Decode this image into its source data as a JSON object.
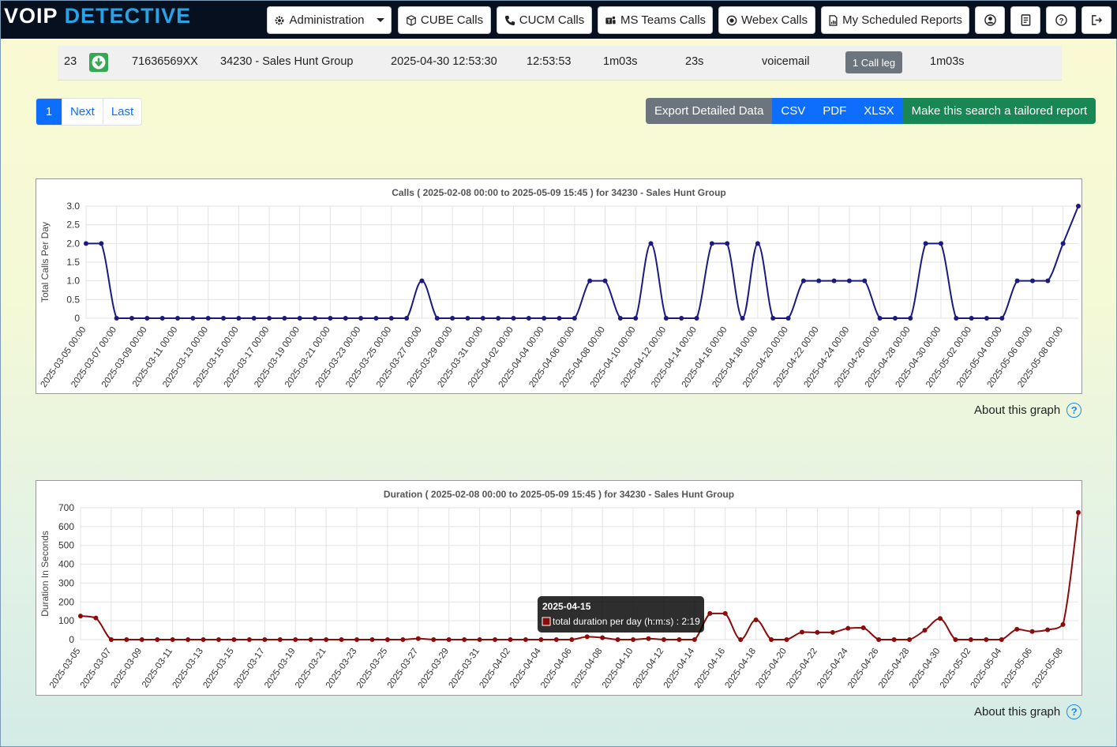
{
  "brand": {
    "logo_v": "V",
    "logo_oip": "OIP",
    "logo_detective": "DETECTIVE"
  },
  "nav": {
    "administration": "Administration",
    "cube_calls": "CUBE Calls",
    "cucm_calls": "CUCM Calls",
    "ms_teams_calls": "MS Teams Calls",
    "webex_calls": "Webex Calls",
    "scheduled_reports": "My Scheduled Reports"
  },
  "call_row": {
    "index": "23",
    "number": "71636569XX",
    "group": "34230 - Sales Hunt Group",
    "start": "2025-04-30 12:53:30",
    "end": "12:53:53",
    "duration": "1m03s",
    "ring": "23s",
    "outcome": "voicemail",
    "call_leg": "1 Call leg",
    "total": "1m03s"
  },
  "pagination": {
    "current": "1",
    "next": "Next",
    "last": "Last"
  },
  "export": {
    "label": "Export Detailed Data",
    "csv": "CSV",
    "pdf": "PDF",
    "xlsx": "XLSX",
    "tailored": "Make this search a tailored report",
    "colors": {
      "label_bg": "#6c757d",
      "format_bg": "#0d6efd",
      "tailored_bg": "#198754"
    }
  },
  "about_graph": "About this graph",
  "tooltip": {
    "title": "2025-04-15",
    "text": "total duration per day (h:m:s) : 2:19"
  },
  "chart_data": [
    {
      "type": "line",
      "title": "Calls ( 2025-02-08 00:00 to 2025-05-09 15:45 ) for 34230 - Sales Hunt Group",
      "ylabel": "Total Calls Per Day",
      "ylim": [
        0,
        3
      ],
      "yticks": [
        "0",
        "0.5",
        "1.0",
        "1.5",
        "2.0",
        "2.5",
        "3.0"
      ],
      "color": "#1a1a80",
      "x_start": "2025-03-05",
      "x_tick_labels": [
        "2025-03-05 00:00",
        "2025-03-07 00:00",
        "2025-03-09 00:00",
        "2025-03-11 00:00",
        "2025-03-13 00:00",
        "2025-03-15 00:00",
        "2025-03-17 00:00",
        "2025-03-19 00:00",
        "2025-03-21 00:00",
        "2025-03-23 00:00",
        "2025-03-25 00:00",
        "2025-03-27 00:00",
        "2025-03-29 00:00",
        "2025-03-31 00:00",
        "2025-04-02 00:00",
        "2025-04-04 00:00",
        "2025-04-06 00:00",
        "2025-04-08 00:00",
        "2025-04-10 00:00",
        "2025-04-12 00:00",
        "2025-04-14 00:00",
        "2025-04-16 00:00",
        "2025-04-18 00:00",
        "2025-04-20 00:00",
        "2025-04-22 00:00",
        "2025-04-24 00:00",
        "2025-04-26 00:00",
        "2025-04-28 00:00",
        "2025-04-30 00:00",
        "2025-05-02 00:00",
        "2025-05-04 00:00",
        "2025-05-06 00:00",
        "2025-05-08 00:00"
      ],
      "values": [
        2,
        2,
        0,
        0,
        0,
        0,
        0,
        0,
        0,
        0,
        0,
        0,
        0,
        0,
        0,
        0,
        0,
        0,
        0,
        0,
        0,
        0,
        1,
        0,
        0,
        0,
        0,
        0,
        0,
        0,
        0,
        0,
        0,
        1,
        1,
        0,
        0,
        2,
        0,
        0,
        0,
        2,
        2,
        0,
        2,
        0,
        0,
        1,
        1,
        1,
        1,
        1,
        0,
        0,
        0,
        2,
        2,
        0,
        0,
        0,
        0,
        1,
        1,
        1,
        2,
        3
      ]
    },
    {
      "type": "line",
      "title": "Duration ( 2025-02-08 00:00 to 2025-05-09 15:45 ) for 34230 - Sales Hunt Group",
      "ylabel": "Duration In Seconds",
      "ylim": [
        0,
        700
      ],
      "yticks": [
        "0",
        "100",
        "200",
        "300",
        "400",
        "500",
        "600",
        "700"
      ],
      "color": "#8b0a0a",
      "x_start": "2025-03-05",
      "x_tick_labels": [
        "2025-03-05",
        "2025-03-07",
        "2025-03-09",
        "2025-03-11",
        "2025-03-13",
        "2025-03-15",
        "2025-03-17",
        "2025-03-19",
        "2025-03-21",
        "2025-03-23",
        "2025-03-25",
        "2025-03-27",
        "2025-03-29",
        "2025-03-31",
        "2025-04-02",
        "2025-04-04",
        "2025-04-06",
        "2025-04-08",
        "2025-04-10",
        "2025-04-12",
        "2025-04-14",
        "2025-04-16",
        "2025-04-18",
        "2025-04-20",
        "2025-04-22",
        "2025-04-24",
        "2025-04-26",
        "2025-04-28",
        "2025-04-30",
        "2025-05-02",
        "2025-05-04",
        "2025-05-06",
        "2025-05-08"
      ],
      "values": [
        125,
        115,
        0,
        0,
        0,
        0,
        0,
        0,
        0,
        0,
        0,
        0,
        0,
        0,
        0,
        0,
        0,
        0,
        0,
        0,
        0,
        0,
        5,
        0,
        0,
        0,
        0,
        0,
        0,
        0,
        0,
        0,
        0,
        15,
        10,
        0,
        0,
        5,
        0,
        0,
        0,
        139,
        139,
        0,
        105,
        0,
        0,
        40,
        38,
        38,
        60,
        63,
        0,
        0,
        0,
        50,
        112,
        0,
        0,
        0,
        0,
        55,
        43,
        52,
        80,
        675
      ]
    }
  ]
}
